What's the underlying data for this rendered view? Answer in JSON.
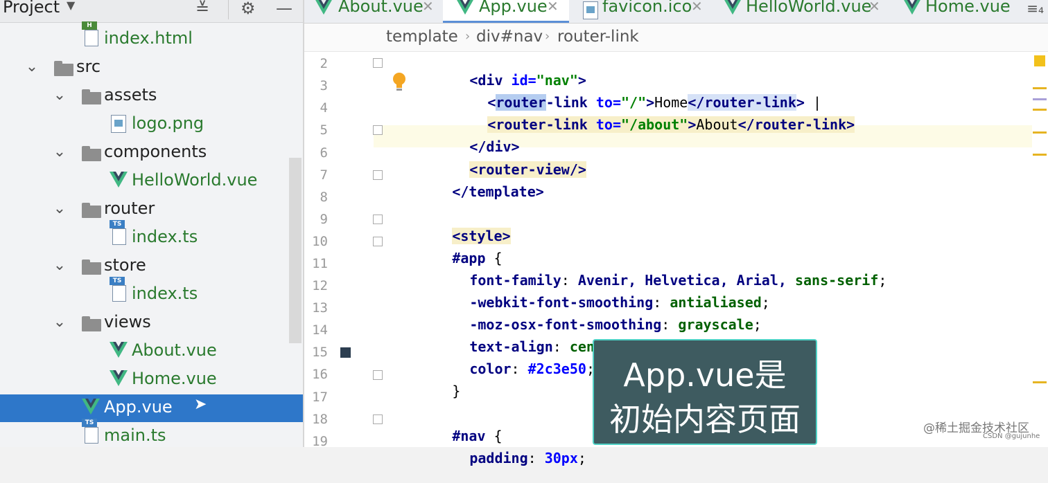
{
  "project_panel": {
    "title": "Project",
    "icons": [
      "chevron-down-icon",
      "collapse-all-icon",
      "gear-icon",
      "minimize-icon"
    ]
  },
  "tree": [
    {
      "label": "index.html",
      "kind": "html-file"
    },
    {
      "label": "src",
      "kind": "folder",
      "expanded": true
    },
    {
      "label": "assets",
      "kind": "folder",
      "expanded": true
    },
    {
      "label": "logo.png",
      "kind": "image-file"
    },
    {
      "label": "components",
      "kind": "folder",
      "expanded": true
    },
    {
      "label": "HelloWorld.vue",
      "kind": "vue-file"
    },
    {
      "label": "router",
      "kind": "folder",
      "expanded": true
    },
    {
      "label": "index.ts",
      "kind": "ts-file"
    },
    {
      "label": "store",
      "kind": "folder",
      "expanded": true
    },
    {
      "label": "index.ts",
      "kind": "ts-file"
    },
    {
      "label": "views",
      "kind": "folder",
      "expanded": true
    },
    {
      "label": "About.vue",
      "kind": "vue-file"
    },
    {
      "label": "Home.vue",
      "kind": "vue-file"
    },
    {
      "label": "App.vue",
      "kind": "vue-file",
      "selected": true
    },
    {
      "label": "main.ts",
      "kind": "ts-file"
    }
  ],
  "tabs": [
    {
      "label": "About.vue",
      "icon": "vue-icon"
    },
    {
      "label": "App.vue",
      "icon": "vue-icon",
      "active": true
    },
    {
      "label": "favicon.ico",
      "icon": "image-icon"
    },
    {
      "label": "HelloWorld.vue",
      "icon": "vue-icon"
    },
    {
      "label": "Home.vue",
      "icon": "vue-icon"
    }
  ],
  "tab_overflow": "≡₄",
  "breadcrumb": [
    "template",
    "div#nav",
    "router-link"
  ],
  "line_numbers": [
    "2",
    "3",
    "4",
    "5",
    "6",
    "7",
    "8",
    "9",
    "10",
    "11",
    "12",
    "13",
    "14",
    "15",
    "16",
    "17",
    "18",
    "19"
  ],
  "code": {
    "l2_open": "<div ",
    "l2_attr": "id=",
    "l2_str": "\"nav\"",
    "l2_close": ">",
    "l3_a": "<",
    "l3_sel": "router",
    "l3_b": "-link ",
    "l3_attr": "to=",
    "l3_str": "\"/\"",
    "l3_c": ">",
    "l3_text": "Home",
    "l3_close_sel": "</router-link",
    "l3_d": ">",
    "l3_caret": " |",
    "l4_a": "<router-link ",
    "l4_attr": "to=",
    "l4_str": "\"/about\"",
    "l4_b": ">",
    "l4_text": "About",
    "l4_close": "</router-link>",
    "l5": "</div>",
    "l6": "<router-view/>",
    "l7": "</template>",
    "l9": "<style>",
    "l10_sel": "#app",
    "l10_brace": " {",
    "l11_prop": "font-family",
    "l11_colon": ": ",
    "l11_val": "Avenir, Helvetica, Arial, ",
    "l11_val2": "sans-serif",
    "l11_end": ";",
    "l12_prop": "-webkit-font-smoothing",
    "l12_colon": ": ",
    "l12_val": "antialiased",
    "l12_end": ";",
    "l13_prop": "-moz-osx-font-smoothing",
    "l13_colon": ": ",
    "l13_val": "grayscale",
    "l13_end": ";",
    "l14_prop": "text-align",
    "l14_colon": ": ",
    "l14_val": "center",
    "l14_end": ";",
    "l15_prop": "color",
    "l15_colon": ": ",
    "l15_val": "#2c3e50",
    "l15_end": ";",
    "l16": "}",
    "l18_sel": "#nav",
    "l18_brace": " {",
    "l19_prop": "padding",
    "l19_colon": ": ",
    "l19_val": "30px",
    "l19_end": ";"
  },
  "caption": {
    "line1": "App.vue是",
    "line2": "初始内容页面"
  },
  "watermark": {
    "main": "@稀土掘金技术社区",
    "sub": "CSDN @gujunhe"
  },
  "colors": {
    "selection": "#2e77c9",
    "vue_green": "#41b883",
    "vue_dark": "#35495e",
    "swatch": "#2c3e50",
    "caption_border": "#4fd1c5"
  }
}
